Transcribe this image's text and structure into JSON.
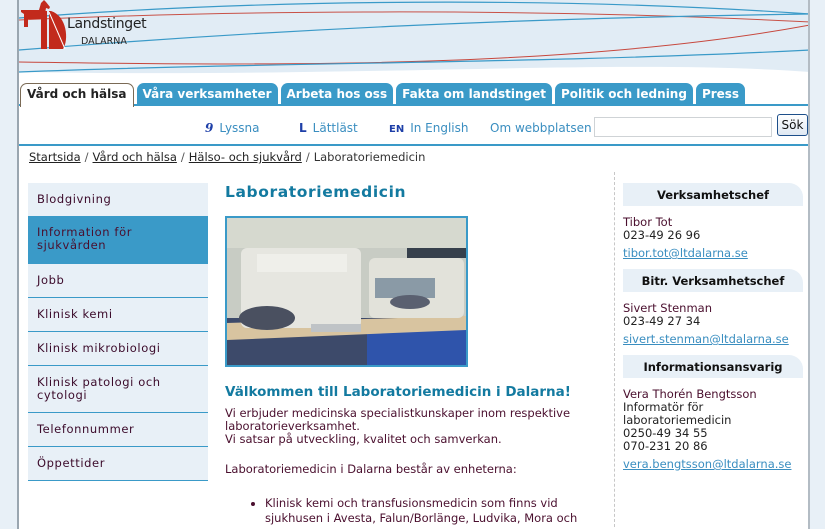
{
  "logo": {
    "main": "Landstinget",
    "sub": "DALARNA"
  },
  "colors": {
    "accent": "#3a9ac8",
    "heading": "#137aa0",
    "logo_red": "#c22a1c",
    "body_text": "#4a0f2e",
    "panel_bg": "#e8f0f7"
  },
  "tabs": [
    {
      "label": "Vård och hälsa",
      "active": true
    },
    {
      "label": "Våra verksamheter",
      "active": false
    },
    {
      "label": "Arbeta hos oss",
      "active": false
    },
    {
      "label": "Fakta om landstinget",
      "active": false
    },
    {
      "label": "Politik och ledning",
      "active": false
    },
    {
      "label": "Press",
      "active": false
    }
  ],
  "utility": {
    "links": [
      {
        "icon": "ear-icon",
        "glyph": "9",
        "label": "Lyssna"
      },
      {
        "icon": "easy-read-icon",
        "glyph": "L",
        "label": "Lättläst"
      },
      {
        "icon": "english-icon",
        "glyph": "EN",
        "label": "In English"
      },
      {
        "icon": "",
        "glyph": "",
        "label": "Om webbplatsen"
      }
    ],
    "search": {
      "value": "",
      "placeholder": "",
      "button": "Sök"
    }
  },
  "breadcrumb": {
    "links": [
      "Startsida",
      "Vård och hälsa",
      "Hälso- och sjukvård"
    ],
    "current": "Laboratoriemedicin",
    "separator": "/"
  },
  "sidebar": {
    "items": [
      {
        "label": "Blodgivning",
        "active": false
      },
      {
        "label": "Information för sjukvården",
        "active": true
      },
      {
        "label": "Jobb",
        "active": false
      },
      {
        "label": "Klinisk kemi",
        "active": false
      },
      {
        "label": "Klinisk mikrobiologi",
        "active": false
      },
      {
        "label": "Klinisk patologi och cytologi",
        "active": false
      },
      {
        "label": "Telefonnummer",
        "active": false
      },
      {
        "label": "Öppettider",
        "active": false
      }
    ]
  },
  "main": {
    "title": "Laboratoriemedicin",
    "photo_alt": "Laboratory analyzers on a bench",
    "welcome": "Välkommen till Laboratoriemedicin i Dalarna!",
    "para1_line1": "Vi erbjuder medicinska specialistkunskaper inom respektive laboratorieverksamhet.",
    "para1_line2": "Vi satsar på utveckling, kvalitet och samverkan.",
    "para2": "Laboratoriemedicin i Dalarna består av enheterna:",
    "bullets": [
      "Klinisk kemi och transfusionsmedicin som finns vid sjukhusen i Avesta, Falun/Borlänge, Ludvika, Mora och"
    ]
  },
  "contacts": [
    {
      "heading": "Verksamhetschef",
      "name": "Tibor Tot",
      "lines": [
        "023-49 26 96"
      ],
      "email": "tibor.tot@ltdalarna.se"
    },
    {
      "heading": "Bitr. Verksamhetschef",
      "name": "Sivert Stenman",
      "lines": [
        "023-49 27 34"
      ],
      "email": "sivert.stenman@ltdalarna.se"
    },
    {
      "heading": "Informationsansvarig",
      "name": "Vera Thorén Bengtsson",
      "lines": [
        "Informatör för",
        "laboratoriemedicin",
        "0250-49 34 55",
        "070-231 20 86"
      ],
      "email": "vera.bengtsson@ltdalarna.se"
    }
  ]
}
